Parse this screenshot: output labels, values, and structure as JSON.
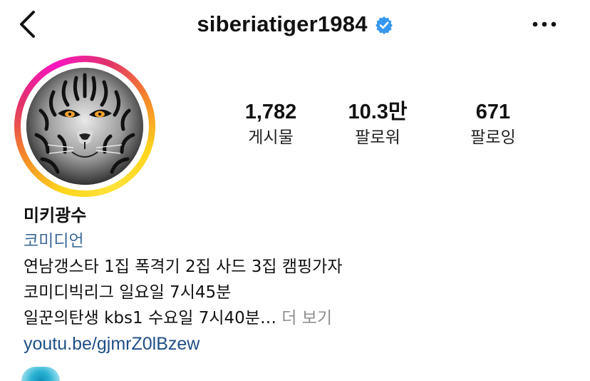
{
  "header": {
    "username": "siberiatiger1984",
    "verified_color": "#3897f0"
  },
  "icons": {
    "back": "chevron-left-icon",
    "verified": "verified-badge-icon",
    "more": "more-horizontal-icon"
  },
  "stats": [
    {
      "value": "1,782",
      "label": "게시물"
    },
    {
      "value": "10.3만",
      "label": "팔로워"
    },
    {
      "value": "671",
      "label": "팔로잉"
    }
  ],
  "bio": {
    "name": "미키광수",
    "category": "코미디언",
    "lines": [
      "연남갱스타 1집 폭격기 2집 사드 3집 캠핑가자",
      "코미디빅리그 일요일 7시45분",
      "일꾼의탄생 kbs1 수요일 7시40분…"
    ],
    "more_label": "더 보기",
    "link": "youtu.be/gjmrZ0lBzew"
  },
  "colors": {
    "category": "#3d6a99",
    "link": "#1f4f86",
    "muted": "#8e8e8e"
  }
}
